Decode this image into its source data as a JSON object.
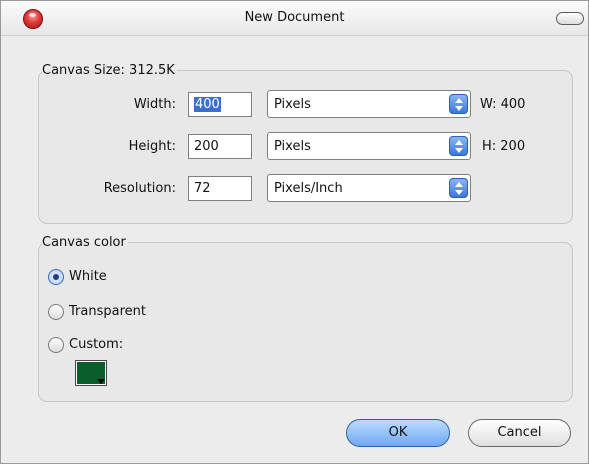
{
  "window": {
    "title": "New Document"
  },
  "canvas_size": {
    "legend": "Canvas Size: 312.5K",
    "width": {
      "label": "Width:",
      "value": "400",
      "unit": "Pixels",
      "readout": "W: 400"
    },
    "height": {
      "label": "Height:",
      "value": "200",
      "unit": "Pixels",
      "readout": "H: 200"
    },
    "resolution": {
      "label": "Resolution:",
      "value": "72",
      "unit": "Pixels/Inch"
    }
  },
  "canvas_color": {
    "legend": "Canvas color",
    "options": [
      {
        "label": "White",
        "selected": true
      },
      {
        "label": "Transparent",
        "selected": false
      },
      {
        "label": "Custom:",
        "selected": false
      }
    ],
    "custom_color": "#0b5e2b"
  },
  "buttons": {
    "ok": "OK",
    "cancel": "Cancel"
  }
}
